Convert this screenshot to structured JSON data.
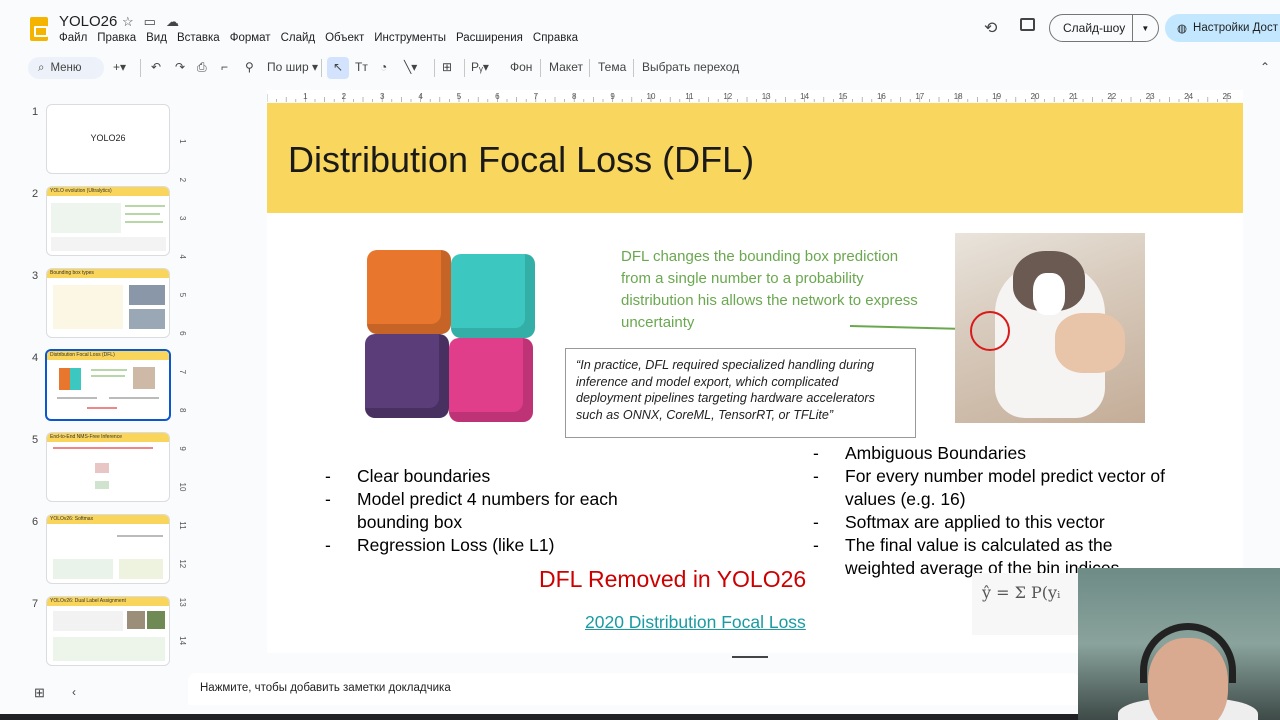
{
  "app": {
    "doc_title": "YOLO26",
    "menu": [
      "Файл",
      "Правка",
      "Вид",
      "Вставка",
      "Формат",
      "Слайд",
      "Объект",
      "Инструменты",
      "Расширения",
      "Справка"
    ],
    "slideshow_label": "Слайд-шоу",
    "share_label": "Настройки Дост"
  },
  "toolbar": {
    "search_label": "Меню",
    "zoom_label": "По шир",
    "background_label": "Фон",
    "layout_label": "Макет",
    "theme_label": "Тема",
    "transition_label": "Выбрать переход"
  },
  "ruler_h": [
    "1",
    "2",
    "3",
    "4",
    "5",
    "6",
    "7",
    "8",
    "9",
    "10",
    "11",
    "12",
    "13",
    "14",
    "15",
    "16",
    "17",
    "18",
    "19",
    "20",
    "21",
    "22",
    "23",
    "24",
    "25"
  ],
  "ruler_v": [
    "1",
    "2",
    "3",
    "4",
    "5",
    "6",
    "7",
    "8",
    "9",
    "10",
    "11",
    "12",
    "13",
    "14"
  ],
  "slides": [
    {
      "num": "1",
      "title": "YOLO26"
    },
    {
      "num": "2",
      "title": "YOLO evolution (Ultralytics)"
    },
    {
      "num": "3",
      "title": "Bounding box types"
    },
    {
      "num": "4",
      "title": "Distribution Focal Loss (DFL)"
    },
    {
      "num": "5",
      "title": "End-to-End NMS-Free Inference"
    },
    {
      "num": "6",
      "title": "YOLOv26: Softmax"
    },
    {
      "num": "7",
      "title": "YOLOv26: Dual Label Assignment"
    }
  ],
  "slide": {
    "title": "Distribution Focal Loss (DFL)",
    "green_text": "DFL changes the bounding box prediction from a single number to a probability distribution his allows the network to express uncertainty",
    "quote": "“In practice, DFL required specialized handling during inference and model export, which complicated deployment pipelines targeting hardware accelerators such as ONNX, CoreML, TensorRT, or TFLite”",
    "left_bullets": [
      "Clear boundaries",
      "Model predict 4 numbers for each bounding box",
      "Regression Loss (like L1)"
    ],
    "right_bullets": [
      "Ambiguous Boundaries",
      "For every number model predict vector of values (e.g. 16)",
      "Softmax are applied to this vector",
      "The final value is calculated as the weighted average of the bin indices"
    ],
    "red_title": "DFL Removed in YOLO26",
    "link": "2020 Distribution Focal Loss",
    "formula": "ŷ = Σ P(yᵢ"
  },
  "notes_placeholder": "Нажмите, чтобы добавить заметки докладчика",
  "colors": {
    "header": "#f9d65e",
    "green": "#6aa84f",
    "red": "#cc0000",
    "link": "#1a9ba1",
    "accent": "#0b57d0"
  }
}
